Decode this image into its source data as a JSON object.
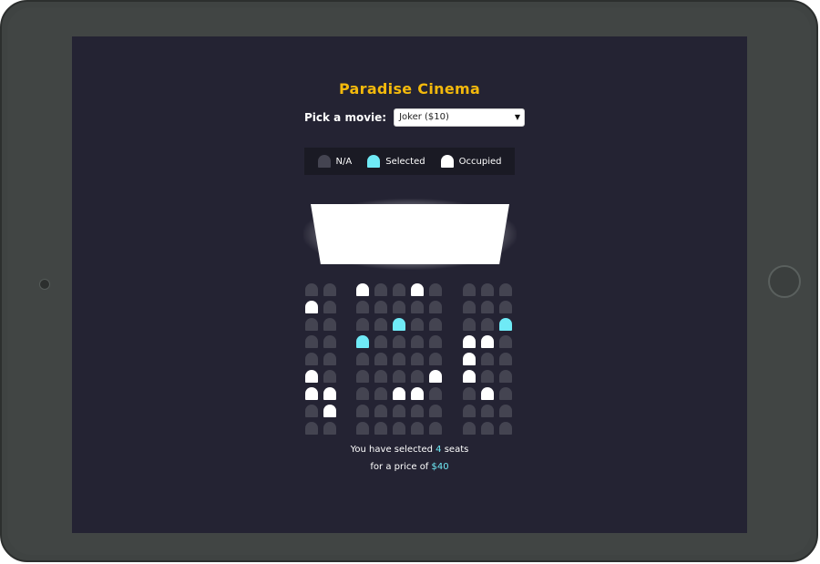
{
  "app": {
    "title": "Paradise Cinema",
    "movie_label": "Pick a movie:",
    "movie_selected": "Joker ($10)"
  },
  "legend": [
    {
      "label": "N/A",
      "status": "na"
    },
    {
      "label": "Selected",
      "status": "selected"
    },
    {
      "label": "Occupied",
      "status": "occupied"
    }
  ],
  "colors": {
    "background": "#242333",
    "seat_na": "#444451",
    "seat_selected": "#6feaf6",
    "seat_occupied": "#ffffff",
    "title": "#f3b90c"
  },
  "seats": [
    "..o..o.......",
    "o............",
    "....s.......s",
    "..s.......oo.",
    "..........o..",
    "o.....o...o..",
    "oo..oo.....o.",
    ".o...........",
    "............."
  ],
  "seat_legend": {
    "na": ".",
    "selected": "s",
    "occupied": "o"
  },
  "summary": {
    "line1_prefix": "You have selected ",
    "count": "4",
    "line1_suffix": " seats",
    "line2_prefix": "for a price of ",
    "total": "$40"
  }
}
